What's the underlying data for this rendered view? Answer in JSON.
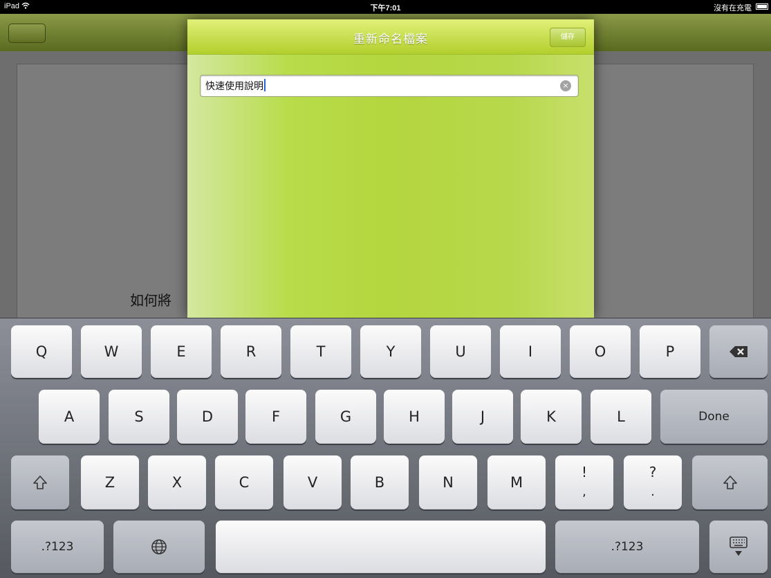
{
  "status_bar": {
    "device": "iPad",
    "time": "下午7:01",
    "charging_status": "沒有在充電"
  },
  "dialog": {
    "title": "重新命名檔案",
    "action_button_label": "儲存",
    "filename_value": "快速使用說明"
  },
  "document": {
    "visible_text": "如何將"
  },
  "keyboard": {
    "row1": [
      "Q",
      "W",
      "E",
      "R",
      "T",
      "Y",
      "U",
      "I",
      "O",
      "P"
    ],
    "row2": [
      "A",
      "S",
      "D",
      "F",
      "G",
      "H",
      "J",
      "K",
      "L"
    ],
    "done_label": "Done",
    "row3": [
      "Z",
      "X",
      "C",
      "V",
      "B",
      "N",
      "M"
    ],
    "punct1": {
      "top": "!",
      "bottom": ","
    },
    "punct2": {
      "top": "?",
      "bottom": "."
    },
    "numbers_label": ".?123",
    "icons": {
      "backspace": "backspace-icon",
      "shift": "shift-icon",
      "globe": "globe-icon",
      "dismiss": "keyboard-dismiss-icon",
      "wifi": "wifi-icon",
      "battery": "battery-icon"
    }
  },
  "colors": {
    "dialog_green": "#b4d63e",
    "nav_olive": "#6f7e30",
    "caret_blue": "#2a62d8"
  }
}
